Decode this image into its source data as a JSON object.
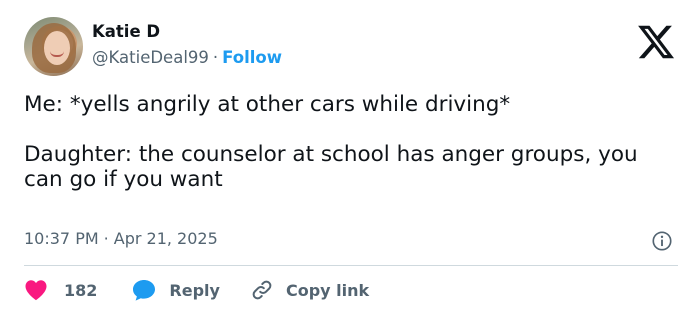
{
  "author": {
    "name": "Katie D",
    "handle": "@KatieDeal99",
    "separator": "·",
    "follow_label": "Follow"
  },
  "tweet": {
    "text": "Me: *yells angrily at other cars while driving*\n\nDaughter: the counselor at school has anger groups, you can go if you want",
    "time": "10:37 PM",
    "separator": "·",
    "date": "Apr 21, 2025"
  },
  "actions": {
    "like_count": "182",
    "reply_label": "Reply",
    "copy_link_label": "Copy link"
  },
  "colors": {
    "accent": "#1d9bf0",
    "like": "#f91880",
    "muted_text": "#536471",
    "text": "#0f1419"
  },
  "icons": [
    "x-logo-icon",
    "info-icon",
    "heart-icon",
    "reply-bubble-icon",
    "link-icon"
  ]
}
